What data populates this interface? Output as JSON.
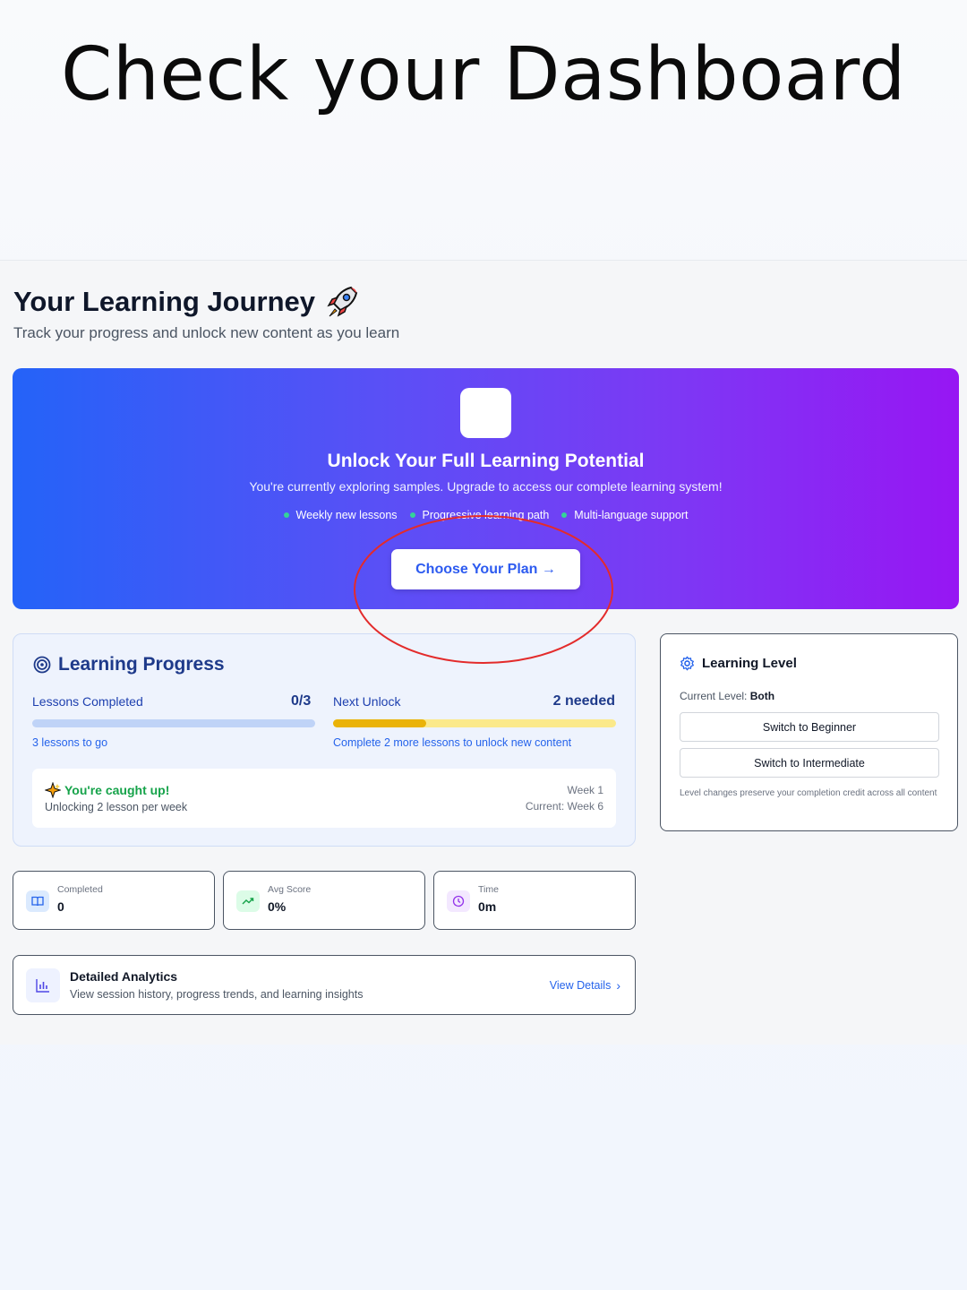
{
  "caption": "Check your Dashboard",
  "header": {
    "title": "Your Learning Journey",
    "subtitle": "Track your progress and unlock new content as you learn",
    "title_icon": "rocket-icon"
  },
  "banner": {
    "title": "Unlock Your Full Learning Potential",
    "subtitle": "You're currently exploring samples. Upgrade to access our complete learning system!",
    "features": [
      "Weekly new lessons",
      "Progressive learning path",
      "Multi-language support"
    ],
    "cta_label": "Choose Your Plan →",
    "gradient_start": "#2463f8",
    "gradient_end": "#9716f3"
  },
  "progress": {
    "title": "Learning Progress",
    "lessons_label": "Lessons Completed",
    "lessons_value": "0/3",
    "lessons_fraction": 0,
    "lessons_hint": "3 lessons to go",
    "unlock_label": "Next Unlock",
    "unlock_value": "2 needed",
    "unlock_fraction": 0.33,
    "unlock_hint": "Complete 2 more lessons to unlock new content",
    "caught_title": "You're caught up!",
    "caught_sub": "Unlocking 2 lesson per week",
    "week": "Week 1",
    "current_week": "Current: Week 6"
  },
  "level": {
    "title": "Learning Level",
    "current_label": "Current Level: ",
    "current_value": "Both",
    "beginner_button": "Switch to Beginner",
    "intermediate_button": "Switch to Intermediate",
    "note": "Level changes preserve your completion credit across all content"
  },
  "stats": [
    {
      "label": "Completed",
      "value": "0",
      "icon": "book-icon"
    },
    {
      "label": "Avg Score",
      "value": "0%",
      "icon": "trend-up-icon"
    },
    {
      "label": "Time",
      "value": "0m",
      "icon": "clock-icon"
    }
  ],
  "analytics": {
    "title": "Detailed Analytics",
    "subtitle": "View session history, progress trends, and learning insights",
    "link": "View Details"
  },
  "colors": {
    "accent": "#2563eb",
    "success": "#16a34a",
    "warning_bar": "#eab308",
    "highlight": "#e32b2b"
  }
}
